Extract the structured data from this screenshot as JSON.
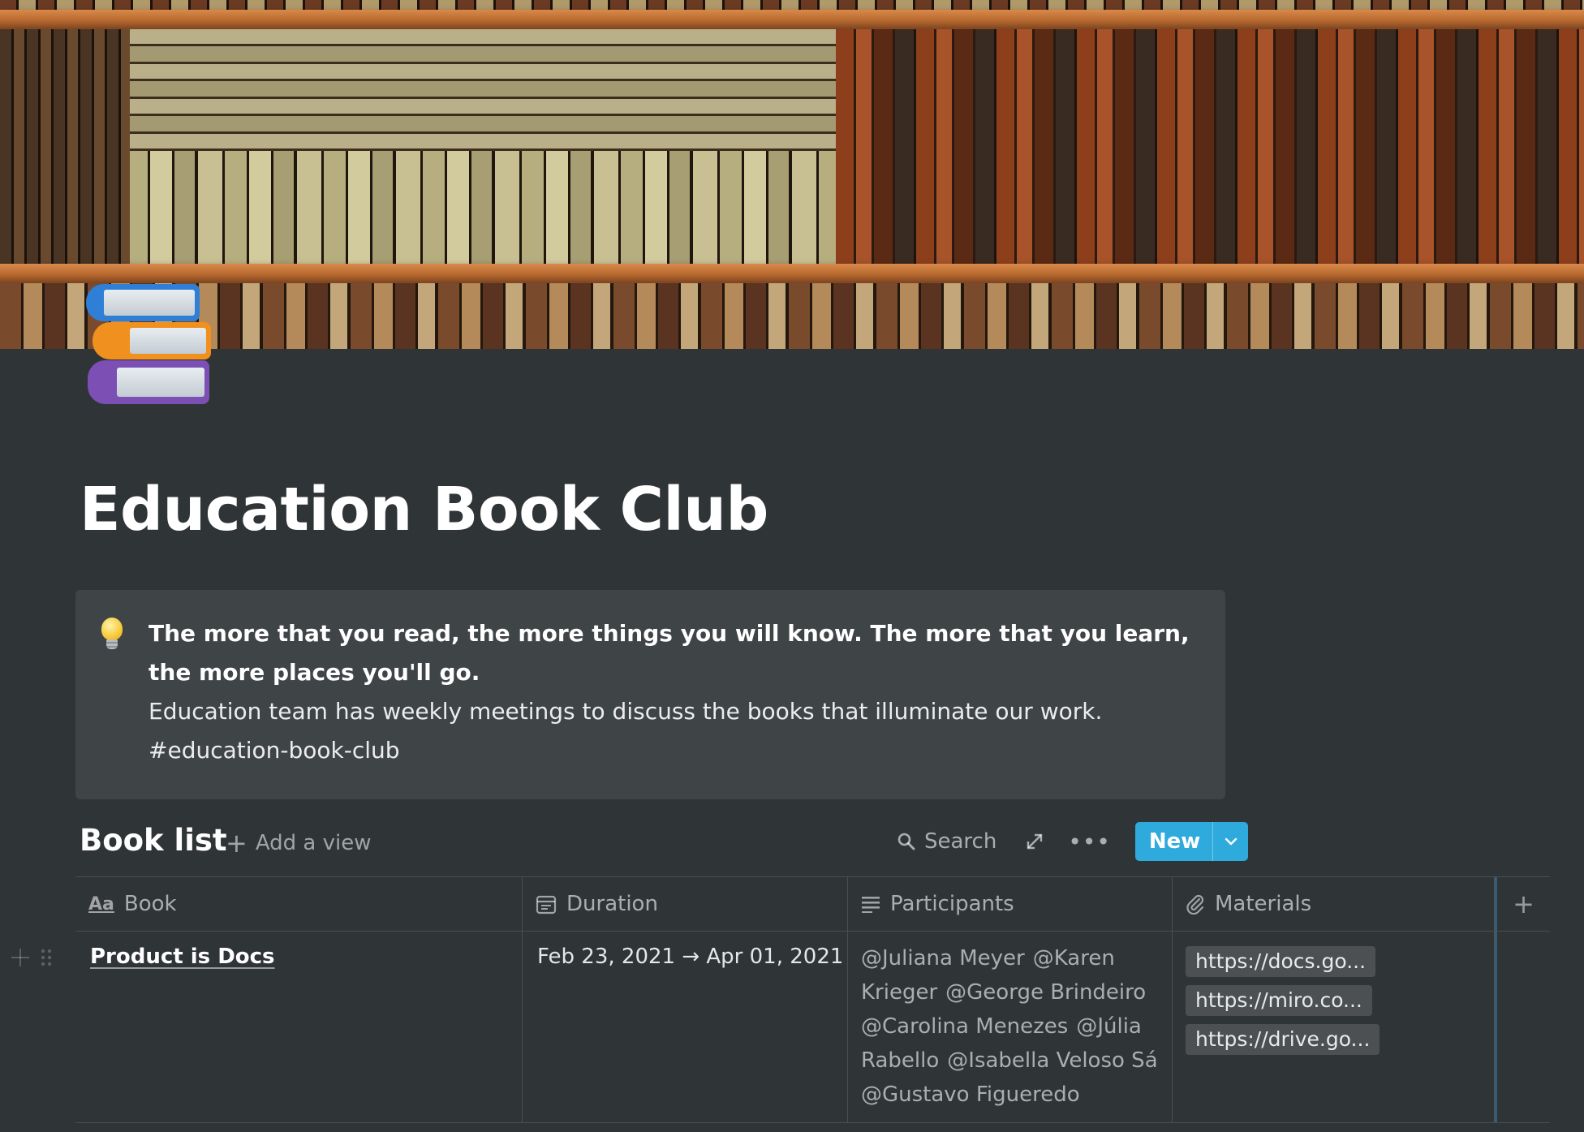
{
  "page": {
    "title": "Education Book Club",
    "icon": "books-emoji-icon",
    "cover": "bookshelf-cover-image"
  },
  "callout": {
    "icon": "light-bulb-icon",
    "quote": "The more that you read, the more things you will know. The more that you learn, the more places you'll go.",
    "line1": "Education team has weekly meetings to discuss the books that illuminate our work.",
    "line2": "#education-book-club"
  },
  "database": {
    "title": "Book list",
    "add_view_label": "Add a view",
    "search_label": "Search",
    "more_label": "•••",
    "new_label": "New",
    "columns": [
      {
        "label": "Book",
        "icon": "title-aa-icon"
      },
      {
        "label": "Duration",
        "icon": "calendar-icon"
      },
      {
        "label": "Participants",
        "icon": "text-lines-icon"
      },
      {
        "label": "Materials",
        "icon": "paperclip-icon"
      }
    ],
    "add_column_label": "+",
    "rows": [
      {
        "book": "Product is Docs",
        "duration": "Feb 23, 2021 → Apr 01, 2021",
        "participants": [
          "@Juliana Meyer",
          "@Karen",
          "Krieger",
          "@George Brindeiro",
          "@Carolina Menezes",
          "@Júlia",
          "Rabello",
          "@Isabella Veloso Sá",
          "@Gustavo Figueredo"
        ],
        "materials": [
          "https://docs.go...",
          "https://miro.co...",
          "https://drive.go..."
        ]
      }
    ]
  },
  "colors": {
    "background": "#2f3437",
    "callout_bg": "#3f4447",
    "accent": "#2eaadc"
  }
}
